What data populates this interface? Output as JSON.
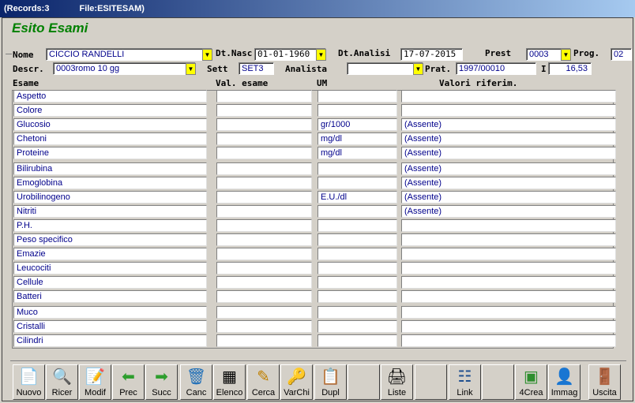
{
  "window": {
    "records": "(Records:3",
    "file": "File:ESITESAM)"
  },
  "heading": "Esito Esami",
  "form": {
    "nome_label": "Nome",
    "nome": "CICCIO RANDELLI",
    "dtnasc_label": "Dt.Nasc",
    "dtnasc": "01-01-1960",
    "dtanalisi_label": "Dt.Analisi",
    "dtanalisi": "17-07-2015",
    "prest_label": "Prest",
    "prest": "0003",
    "prog_label": "Prog.",
    "prog": "02",
    "descr_label": "Descr.",
    "descr": "0003romo 10 gg",
    "sett_label": "Sett",
    "sett": "SET3",
    "analista_label": "Analista",
    "analista": "",
    "prat_label": "Prat.",
    "prat": "1997/00010",
    "i_label": "I",
    "i": "16,53"
  },
  "columns": {
    "esame": "Esame",
    "val": "Val. esame",
    "um": "UM",
    "rif": "Valori riferim."
  },
  "rows": [
    {
      "esame": "Aspetto",
      "val": "",
      "um": "",
      "rif": ""
    },
    {
      "esame": "Colore",
      "val": "",
      "um": "",
      "rif": ""
    },
    {
      "esame": "Glucosio",
      "val": "",
      "um": "gr/1000",
      "rif": "(Assente)"
    },
    {
      "esame": "Chetoni",
      "val": "",
      "um": "mg/dl",
      "rif": "(Assente)"
    },
    {
      "esame": "Proteine",
      "val": "",
      "um": "mg/dl",
      "rif": "(Assente)"
    },
    {
      "esame": "Bilirubina",
      "val": "",
      "um": "",
      "rif": "(Assente)"
    },
    {
      "esame": "Emoglobina",
      "val": "",
      "um": "",
      "rif": "(Assente)"
    },
    {
      "esame": "Urobilinogeno",
      "val": "",
      "um": "E.U./dl",
      "rif": "(Assente)"
    },
    {
      "esame": "Nitriti",
      "val": "",
      "um": "",
      "rif": "(Assente)"
    },
    {
      "esame": "P.H.",
      "val": "",
      "um": "",
      "rif": ""
    },
    {
      "esame": "Peso specifico",
      "val": "",
      "um": "",
      "rif": ""
    },
    {
      "esame": "Emazie",
      "val": "",
      "um": "",
      "rif": ""
    },
    {
      "esame": "Leucociti",
      "val": "",
      "um": "",
      "rif": ""
    },
    {
      "esame": "Cellule",
      "val": "",
      "um": "",
      "rif": ""
    },
    {
      "esame": "Batteri",
      "val": "",
      "um": "",
      "rif": ""
    },
    {
      "esame": "Muco",
      "val": "",
      "um": "",
      "rif": ""
    },
    {
      "esame": "Cristalli",
      "val": "",
      "um": "",
      "rif": ""
    },
    {
      "esame": "Cilindri",
      "val": "",
      "um": "",
      "rif": ""
    }
  ],
  "toolbar": {
    "nuovo": "Nuovo",
    "ricer": "Ricer",
    "modif": "Modif",
    "prec": "Prec",
    "succ": "Succ",
    "canc": "Canc",
    "elenco": "Elenco",
    "cerca": "Cerca",
    "varchi": "VarChi",
    "dupl": "Dupl",
    "liste": "Liste",
    "link": "Link",
    "crea": "4Crea",
    "immag": "Immag",
    "uscita": "Uscita"
  }
}
